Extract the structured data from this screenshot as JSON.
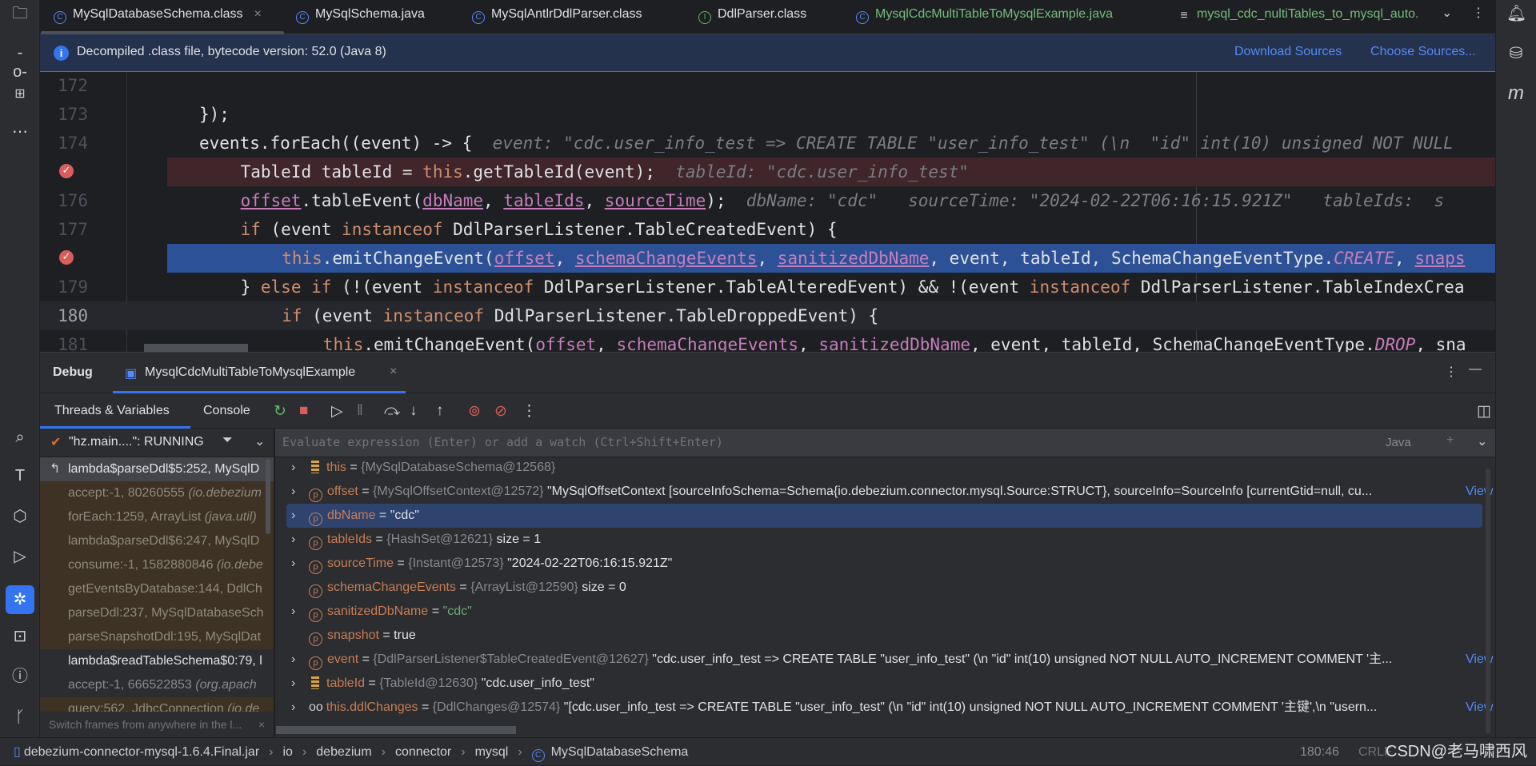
{
  "tabs": [
    {
      "label": "MySqlDatabaseSchema.class",
      "icon": "class-icon",
      "active": true,
      "color": "#dfe1e5"
    },
    {
      "label": "MySqlSchema.java",
      "icon": "class-icon",
      "color": "#dfe1e5"
    },
    {
      "label": "MySqlAntlrDdlParser.class",
      "icon": "class-icon",
      "color": "#dfe1e5"
    },
    {
      "label": "DdlParser.class",
      "icon": "interface-icon",
      "color": "#dfe1e5"
    },
    {
      "label": "MysqlCdcMultiTableToMysqlExample.java",
      "icon": "class-icon",
      "color": "#73bd79"
    },
    {
      "label": "mysql_cdc_nultiTables_to_mysql_auto.",
      "icon": "text-file-icon",
      "color": "#73bd79"
    }
  ],
  "banner": {
    "text": "Decompiled .class file, bytecode version: 52.0 (Java 8)",
    "download": "Download Sources",
    "choose": "Choose Sources..."
  },
  "code": [
    {
      "n": "172",
      "t": []
    },
    {
      "n": "173",
      "i": 1,
      "t": [
        [
          "});",
          ""
        ]
      ]
    },
    {
      "n": "174",
      "i": 1,
      "t": [
        [
          "events.forEach((event) -> {",
          ""
        ],
        [
          "  event: \"cdc.user_info_test => CREATE TABLE \"user_info_test\" (\\n  \"id\" int(10) unsigned NOT NULL",
          "hint"
        ]
      ]
    },
    {
      "n": "",
      "i": 2,
      "bp": true,
      "bg": "#40252b",
      "t": [
        [
          "TableId tableId = ",
          ""
        ],
        [
          "this",
          "kw"
        ],
        [
          ".getTableId(event);",
          ""
        ],
        [
          "  tableId: \"cdc.user_info_test\"",
          "hint"
        ]
      ]
    },
    {
      "n": "176",
      "i": 2,
      "t": [
        [
          "offset",
          "fld"
        ],
        [
          ".tableEvent(",
          ""
        ],
        [
          "dbName",
          "fld"
        ],
        [
          ", ",
          ""
        ],
        [
          "tableIds",
          "fld"
        ],
        [
          ", ",
          ""
        ],
        [
          "sourceTime",
          "fld"
        ],
        [
          ");",
          ""
        ],
        [
          "  dbName: \"cdc\"   sourceTime: \"2024-02-22T06:16:15.921Z\"   tableIds:  s",
          "hint"
        ]
      ]
    },
    {
      "n": "177",
      "i": 2,
      "t": [
        [
          "if",
          "kw"
        ],
        [
          " (event ",
          ""
        ],
        [
          "instanceof",
          "kw"
        ],
        [
          " DdlParserListener.TableCreatedEvent) {",
          ""
        ]
      ]
    },
    {
      "n": "",
      "i": 3,
      "bp": true,
      "bg": "#2c5196",
      "t": [
        [
          "this",
          "kw"
        ],
        [
          ".emitChangeEvent(",
          ""
        ],
        [
          "offset",
          "fld"
        ],
        [
          ", ",
          ""
        ],
        [
          "schemaChangeEvents",
          "fld"
        ],
        [
          ", ",
          ""
        ],
        [
          "sanitizedDbName",
          "fld"
        ],
        [
          ", event, tableId, SchemaChangeEventType.",
          ""
        ],
        [
          "CREATE",
          "en"
        ],
        [
          ", ",
          ""
        ],
        [
          "snaps",
          "fld"
        ]
      ]
    },
    {
      "n": "179",
      "i": 2,
      "t": [
        [
          "} ",
          ""
        ],
        [
          "else if",
          "kw"
        ],
        [
          " (!(event ",
          ""
        ],
        [
          "instanceof",
          "kw"
        ],
        [
          " DdlParserListener.TableAlteredEvent) && !(event ",
          ""
        ],
        [
          "instanceof",
          "kw"
        ],
        [
          " DdlParserListener.TableIndexCrea",
          ""
        ]
      ]
    },
    {
      "n": "180",
      "i": 3,
      "cur": true,
      "bg": "#26282e",
      "t": [
        [
          "if",
          "kw"
        ],
        [
          " (event ",
          ""
        ],
        [
          "instanceof",
          "kw"
        ],
        [
          " DdlParserListener.TableDroppedEvent) {",
          ""
        ]
      ]
    },
    {
      "n": "181",
      "i": 4,
      "t": [
        [
          "this",
          "kw"
        ],
        [
          ".emitChangeEvent(",
          ""
        ],
        [
          "offset",
          "fld"
        ],
        [
          ", ",
          ""
        ],
        [
          "schemaChangeEvents",
          "fld"
        ],
        [
          ", ",
          ""
        ],
        [
          "sanitizedDbName",
          "fld"
        ],
        [
          ", event, tableId, SchemaChangeEventType.",
          ""
        ],
        [
          "DROP",
          "en"
        ],
        [
          ", sna",
          ""
        ]
      ]
    }
  ],
  "debug": {
    "title": "Debug",
    "session": "MysqlCdcMultiTableToMysqlExample",
    "tab_threads": "Threads & Variables",
    "tab_console": "Console",
    "thread": "\"hz.main....\": RUNNING",
    "eval_placeholder": "Evaluate expression (Enter) or add a watch (Ctrl+Shift+Enter)",
    "lang": "Java",
    "tip": "Switch frames from anywhere in the l..."
  },
  "frames": [
    {
      "text": "lambda$parseDdl$5:252, MySqlD",
      "kind": "sel"
    },
    {
      "text": "accept:-1, 80260555 ",
      "it": "(io.debezium",
      "kind": "lib"
    },
    {
      "text": "forEach:1259, ArrayList ",
      "it": "(java.util)",
      "kind": "lib"
    },
    {
      "text": "lambda$parseDdl$6:247, MySqlD",
      "kind": "lib"
    },
    {
      "text": "consume:-1, 1582880846 ",
      "it": "(io.debe",
      "kind": "lib"
    },
    {
      "text": "getEventsByDatabase:144, DdlCh",
      "kind": "lib"
    },
    {
      "text": "parseDdl:237, MySqlDatabaseSch",
      "kind": "lib"
    },
    {
      "text": "parseSnapshotDdl:195, MySqlDat",
      "kind": "lib"
    },
    {
      "text": "lambda$readTableSchema$0:79, l",
      "kind": "norm"
    },
    {
      "text": "accept:-1, 666522853 ",
      "it": "(org.apach",
      "kind": "dim"
    },
    {
      "text": "query:562, JdbcConnection ",
      "it": "(io.de",
      "kind": "lib"
    }
  ],
  "vars": [
    {
      "exp": true,
      "icon": "field-list-icon",
      "name": "this",
      "type": "{MySqlDatabaseSchema@12568}",
      "val": ""
    },
    {
      "exp": true,
      "icon": "p",
      "name": "offset",
      "type": "{MySqlOffsetContext@12572}",
      "val": "\"MySqlOffsetContext [sourceInfoSchema=Schema{io.debezium.connector.mysql.Source:STRUCT}, sourceInfo=SourceInfo [currentGtid=null, cu...",
      "view": "View"
    },
    {
      "exp": true,
      "icon": "p",
      "name": "dbName",
      "type": "",
      "val": "\"cdc\"",
      "sel": true
    },
    {
      "exp": true,
      "icon": "p",
      "name": "tableIds",
      "type": "{HashSet@12621}",
      "val": " size = 1"
    },
    {
      "exp": true,
      "icon": "p",
      "name": "sourceTime",
      "type": "{Instant@12573}",
      "val": "\"2024-02-22T06:16:15.921Z\""
    },
    {
      "exp": false,
      "icon": "p",
      "name": "schemaChangeEvents",
      "type": "{ArrayList@12590}",
      "val": " size = 0"
    },
    {
      "exp": true,
      "icon": "p",
      "name": "sanitizedDbName",
      "type": "",
      "val": "\"cdc\"",
      "green": true
    },
    {
      "exp": false,
      "icon": "p",
      "name": "snapshot",
      "type": "",
      "val": "true"
    },
    {
      "exp": true,
      "icon": "p",
      "name": "event",
      "type": "{DdlParserListener$TableCreatedEvent@12627}",
      "val": "\"cdc.user_info_test => CREATE TABLE \"user_info_test\" (\\n  \"id\" int(10) unsigned NOT NULL AUTO_INCREMENT COMMENT '主...",
      "view": "View"
    },
    {
      "exp": true,
      "icon": "field-list-icon",
      "name": "tableId",
      "type": "{TableId@12630}",
      "val": "\"cdc.user_info_test\""
    },
    {
      "exp": true,
      "icon": "watch-icon",
      "name": "this.ddlChanges",
      "type": "{DdlChanges@12574}",
      "val": "\"[cdc.user_info_test => CREATE TABLE \"user_info_test\" (\\n  \"id\" int(10) unsigned NOT NULL AUTO_INCREMENT COMMENT '主键',\\n  \"usern...",
      "view": "View"
    }
  ],
  "breadcrumb": [
    "debezium-connector-mysql-1.6.4.Final.jar",
    "io",
    "debezium",
    "connector",
    "mysql",
    "MySqlDatabaseSchema"
  ],
  "status": {
    "position": "180:46",
    "line_sep": "CRLF",
    "watermark": "CSDN@老马啸西风"
  },
  "colors": {
    "accent": "#3574f0",
    "breakpoint": "#db5c5c",
    "exec_line": "#2c5196",
    "bp_line": "#40252b"
  }
}
